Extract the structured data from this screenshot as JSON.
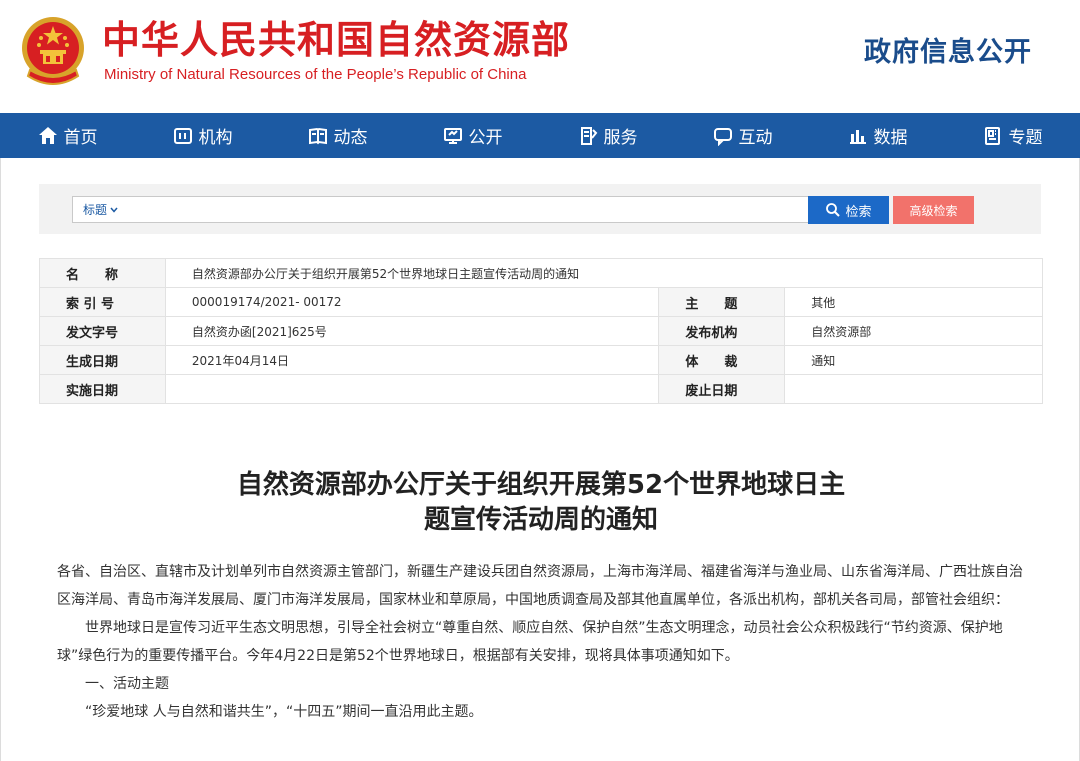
{
  "header": {
    "site_title": "中华人民共和国自然资源部",
    "site_subtitle": "Ministry of Natural Resources of the People’s Republic of China",
    "gov_info": "政府信息公开"
  },
  "nav": {
    "items": [
      {
        "label": "首页",
        "icon": "home-icon"
      },
      {
        "label": "机构",
        "icon": "organization-icon"
      },
      {
        "label": "动态",
        "icon": "book-icon"
      },
      {
        "label": "公开",
        "icon": "monitor-icon"
      },
      {
        "label": "服务",
        "icon": "document-edit-icon"
      },
      {
        "label": "互动",
        "icon": "chat-icon"
      },
      {
        "label": "数据",
        "icon": "bar-chart-icon"
      },
      {
        "label": "专题",
        "icon": "topic-icon"
      }
    ]
  },
  "search": {
    "select_value": "标题",
    "query": "",
    "search_label": "检索",
    "advanced_label": "高级检索"
  },
  "meta": {
    "name_label": "名　　称",
    "name_value": "自然资源部办公厅关于组织开展第52个世界地球日主题宣传活动周的通知",
    "index_label": "索 引 号",
    "index_value": "000019174/2021- 00172",
    "subject_label": "主　　题",
    "subject_value": "其他",
    "doc_no_label": "发文字号",
    "doc_no_value": "自然资办函[2021]625号",
    "publisher_label": "发布机构",
    "publisher_value": "自然资源部",
    "date_label": "生成日期",
    "date_value": "2021年04月14日",
    "genre_label": "体　　裁",
    "genre_value": "通知",
    "effective_label": "实施日期",
    "effective_value": "",
    "expiry_label": "废止日期",
    "expiry_value": ""
  },
  "article": {
    "title_line1": "自然资源部办公厅关于组织开展第52个世界地球日主",
    "title_line2": "题宣传活动周的通知",
    "para1": "各省、自治区、直辖市及计划单列市自然资源主管部门，新疆生产建设兵团自然资源局，上海市海洋局、福建省海洋与渔业局、山东省海洋局、广西壮族自治区海洋局、青岛市海洋发展局、厦门市海洋发展局，国家林业和草原局，中国地质调查局及部其他直属单位，各派出机构，部机关各司局，部管社会组织：",
    "para2": "世界地球日是宣传习近平生态文明思想，引导全社会树立“尊重自然、顺应自然、保护自然”生态文明理念，动员社会公众积极践行“节约资源、保护地球”绿色行为的重要传播平台。今年4月22日是第52个世界地球日，根据部有关安排，现将具体事项通知如下。",
    "heading1": "一、活动主题",
    "para3": "“珍爱地球 人与自然和谐共生”，“十四五”期间一直沿用此主题。"
  },
  "colors": {
    "brand_red": "#d71f22",
    "nav_blue": "#1c5aa3",
    "search_blue": "#1c69c7",
    "advanced_red": "#f2726b"
  }
}
